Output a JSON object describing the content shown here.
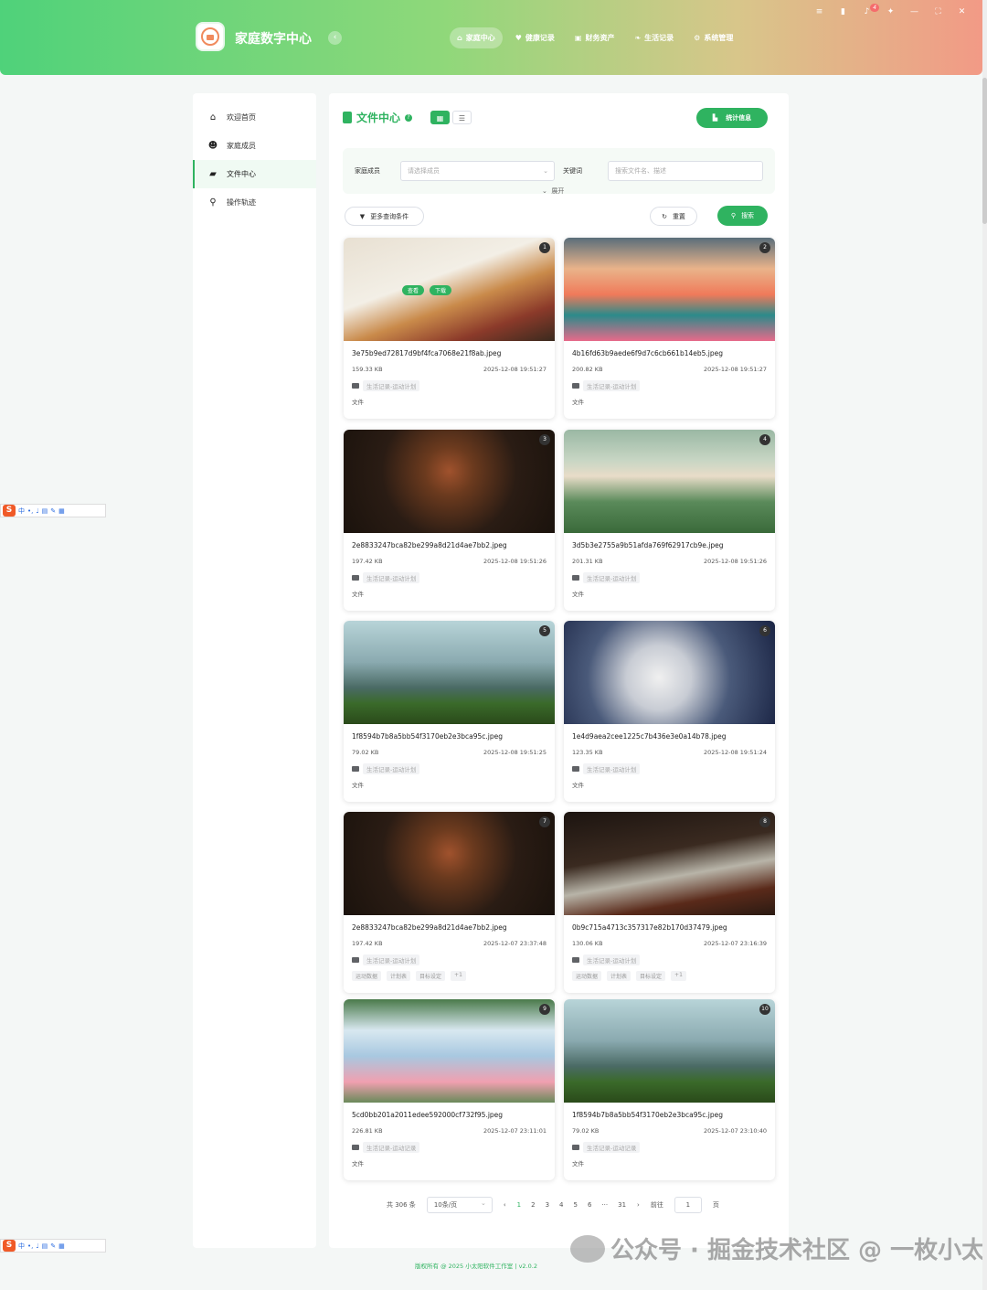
{
  "header": {
    "app_title": "家庭数字中心",
    "nav": [
      {
        "label": "家庭中心",
        "icon": "home-icon",
        "active": true
      },
      {
        "label": "健康记录",
        "icon": "heart-icon",
        "active": false
      },
      {
        "label": "财务资产",
        "icon": "wallet-icon",
        "active": false
      },
      {
        "label": "生活记录",
        "icon": "leaf-icon",
        "active": false
      },
      {
        "label": "系统管理",
        "icon": "gears-icon",
        "active": false
      }
    ],
    "notification_count": "4"
  },
  "sidebar": {
    "items": [
      {
        "label": "欢迎首页",
        "icon": "home-icon"
      },
      {
        "label": "家庭成员",
        "icon": "users-icon"
      },
      {
        "label": "文件中心",
        "icon": "folder-open-icon",
        "active": true
      },
      {
        "label": "操作轨迹",
        "icon": "track-icon"
      }
    ]
  },
  "main": {
    "title": "文件中心",
    "stats_button": "统计信息",
    "filter": {
      "member_label": "家庭成员",
      "member_placeholder": "请选择成员",
      "keyword_label": "关键词",
      "keyword_placeholder": "搜索文件名、描述",
      "expand_label": "展开"
    },
    "more_conditions": "更多查询条件",
    "reset": "重置",
    "search": "搜索",
    "hover_actions": {
      "view": "查看",
      "download": "下载"
    },
    "cards": [
      {
        "index": "1",
        "name": "3e75b9ed72817d9bf4fca7068e21f8ab.jpeg",
        "size": "159.33 KB",
        "date": "2025-12-08 19:51:27",
        "category": "生活记录-运动计划",
        "type": "文件",
        "thumb": "food"
      },
      {
        "index": "2",
        "name": "4b16fd63b9aede6f9d7c6cb661b14eb5.jpeg",
        "size": "200.82 KB",
        "date": "2025-12-08 19:51:27",
        "category": "生活记录-运动计划",
        "type": "文件",
        "thumb": "lake"
      },
      {
        "index": "3",
        "name": "2e8833247bca82be299a8d21d4ae7bb2.jpeg",
        "size": "197.42 KB",
        "date": "2025-12-08 19:51:26",
        "category": "生活记录-运动计划",
        "type": "文件",
        "thumb": "queen"
      },
      {
        "index": "4",
        "name": "3d5b3e2755a9b51afda769f62917cb9e.jpeg",
        "size": "201.31 KB",
        "date": "2025-12-08 19:51:26",
        "category": "生活记录-运动计划",
        "type": "文件",
        "thumb": "dog"
      },
      {
        "index": "5",
        "name": "1f8594b7b8a5bb54f3170eb2e3bca95c.jpeg",
        "size": "79.02 KB",
        "date": "2025-12-08 19:51:25",
        "category": "生活记录-运动计划",
        "type": "文件",
        "thumb": "city"
      },
      {
        "index": "6",
        "name": "1e4d9aea2cee1225c7b436e3e0a14b78.jpeg",
        "size": "123.35 KB",
        "date": "2025-12-08 19:51:24",
        "category": "生活记录-运动计划",
        "type": "文件",
        "thumb": "pod"
      },
      {
        "index": "7",
        "name": "2e8833247bca82be299a8d21d4ae7bb2.jpeg",
        "size": "197.42 KB",
        "date": "2025-12-07 23:37:48",
        "category": "生活记录-运动计划",
        "tags": [
          "运动数据",
          "计划表",
          "目标设定",
          "+1"
        ],
        "thumb": "queen"
      },
      {
        "index": "8",
        "name": "0b9c715a4713c357317e82b170d37479.jpeg",
        "size": "130.06 KB",
        "date": "2025-12-07 23:16:39",
        "category": "生活记录-运动计划",
        "tags": [
          "运动数据",
          "计划表",
          "目标设定",
          "+1"
        ],
        "thumb": "tea"
      },
      {
        "index": "9",
        "name": "5cd0bb201a2011edee592000cf732f95.jpeg",
        "size": "226.81 KB",
        "date": "2025-12-07 23:11:01",
        "category": "生活记录-运动记录",
        "type": "文件",
        "thumb": "sky"
      },
      {
        "index": "10",
        "name": "1f8594b7b8a5bb54f3170eb2e3bca95c.jpeg",
        "size": "79.02 KB",
        "date": "2025-12-07 23:10:40",
        "category": "生活记录-运动记录",
        "type": "文件",
        "thumb": "city"
      }
    ],
    "pagination": {
      "total": "共 306 条",
      "page_size": "10条/页",
      "pages": [
        "1",
        "2",
        "3",
        "4",
        "5",
        "6",
        "···",
        "31"
      ],
      "current": "1",
      "goto_label": "前往",
      "goto_value": "1",
      "page_suffix": "页"
    }
  },
  "footer": "版权所有 @ 2025 小太阳软件工作室  |  v2.0.2",
  "watermark": "公众号 · 掘金技术社区 @ 一枚小太阳",
  "ime_toolbar": {
    "logo": "S",
    "mode": "中"
  },
  "colors": {
    "accent": "#2fb360",
    "header_start": "#4fd27a",
    "header_end": "#f29a86"
  }
}
